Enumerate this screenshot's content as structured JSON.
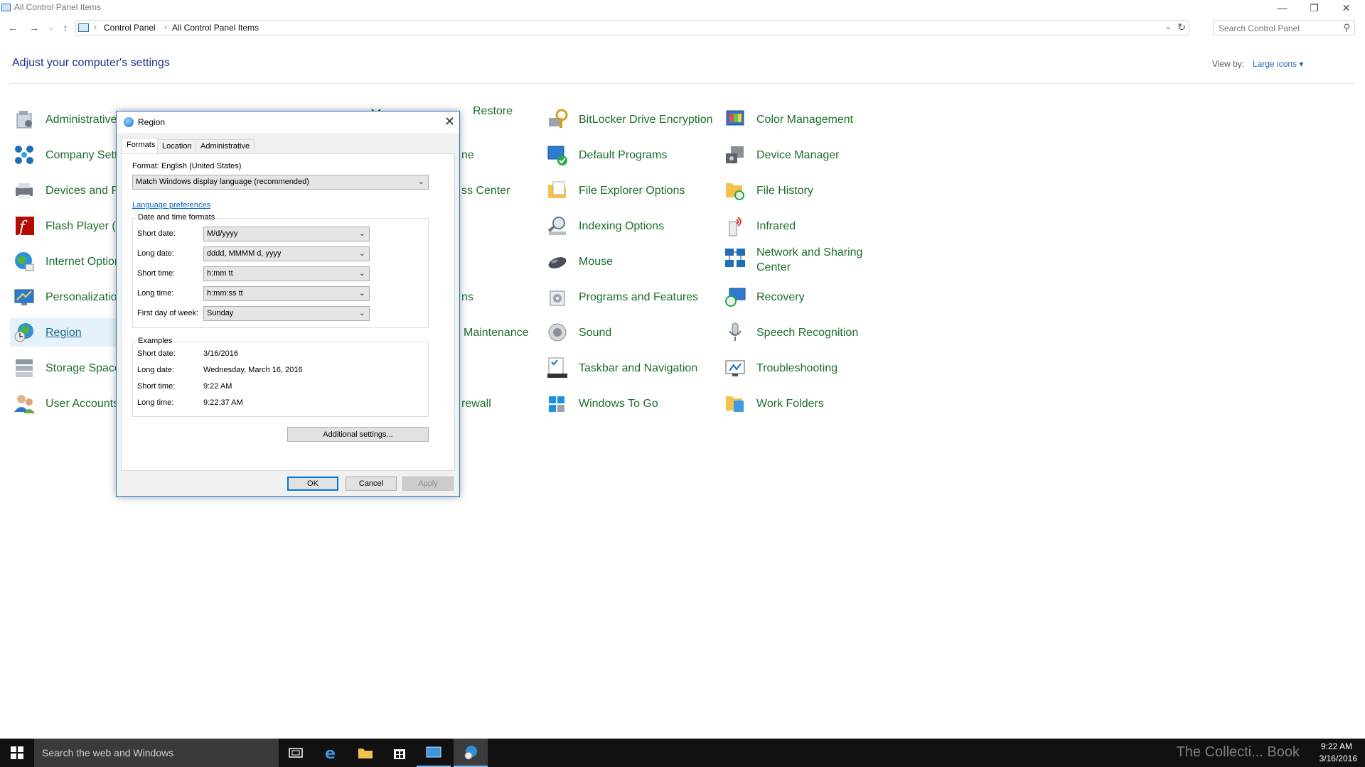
{
  "window": {
    "title": "All Control Panel Items",
    "minimize": "—",
    "restore": "❐",
    "close": "✕"
  },
  "address": {
    "crumbs": [
      "Control Panel",
      "All Control Panel Items"
    ],
    "separator": "›",
    "search_placeholder": "Search Control Panel"
  },
  "header": {
    "title": "Adjust your computer's settings",
    "view_by_label": "View by:",
    "view_by_value": "Large icons ▾"
  },
  "items": {
    "col1": [
      {
        "label": "Administrative",
        "icon": "administrative-tools-icon"
      },
      {
        "label": "Company Setti",
        "icon": "company-settings-icon"
      },
      {
        "label": "Devices and Pr",
        "icon": "devices-printers-icon"
      },
      {
        "label": "Flash Player (3",
        "icon": "flash-player-icon"
      },
      {
        "label": "Internet Option",
        "icon": "internet-options-icon"
      },
      {
        "label": "Personalizatio",
        "icon": "personalization-icon"
      },
      {
        "label": "Region",
        "icon": "region-icon"
      },
      {
        "label": "Storage Spaces",
        "icon": "storage-spaces-icon"
      },
      {
        "label": "User Accounts",
        "icon": "user-accounts-icon"
      }
    ],
    "col2_partial": [
      {
        "label": "Restore"
      },
      {
        "label": "ne"
      },
      {
        "label": "ss Center"
      },
      {
        "label": "ns"
      },
      {
        "label": "Maintenance"
      },
      {
        "label": "rewall"
      }
    ],
    "col3": [
      {
        "label": "BitLocker Drive Encryption",
        "icon": "bitlocker-icon"
      },
      {
        "label": "Default Programs",
        "icon": "default-programs-icon"
      },
      {
        "label": "File Explorer Options",
        "icon": "file-explorer-options-icon"
      },
      {
        "label": "Indexing Options",
        "icon": "indexing-options-icon"
      },
      {
        "label": "Mouse",
        "icon": "mouse-icon"
      },
      {
        "label": "Programs and Features",
        "icon": "programs-features-icon"
      },
      {
        "label": "Sound",
        "icon": "sound-icon"
      },
      {
        "label": "Taskbar and Navigation",
        "icon": "taskbar-navigation-icon"
      },
      {
        "label": "Windows To Go",
        "icon": "windows-to-go-icon"
      }
    ],
    "col4": [
      {
        "label": "Color Management",
        "icon": "color-management-icon"
      },
      {
        "label": "Device Manager",
        "icon": "device-manager-icon"
      },
      {
        "label": "File History",
        "icon": "file-history-icon"
      },
      {
        "label": "Infrared",
        "icon": "infrared-icon"
      },
      {
        "label": "Network and Sharing Center",
        "icon": "network-sharing-icon"
      },
      {
        "label": "Recovery",
        "icon": "recovery-icon"
      },
      {
        "label": "Speech Recognition",
        "icon": "speech-recognition-icon"
      },
      {
        "label": "Troubleshooting",
        "icon": "troubleshooting-icon"
      },
      {
        "label": "Work Folders",
        "icon": "work-folders-icon"
      }
    ]
  },
  "dialog": {
    "title": "Region",
    "close": "✕",
    "tabs": [
      "Formats",
      "Location",
      "Administrative"
    ],
    "active_tab": "Formats",
    "format_label": "Format: English (United States)",
    "format_value": "Match Windows display language (recommended)",
    "language_link": "Language preferences",
    "datetime_group": "Date and time formats",
    "fields": [
      {
        "label": "Short date:",
        "value": "M/d/yyyy"
      },
      {
        "label": "Long date:",
        "value": "dddd, MMMM d, yyyy"
      },
      {
        "label": "Short time:",
        "value": "h:mm tt"
      },
      {
        "label": "Long time:",
        "value": "h:mm:ss tt"
      },
      {
        "label": "First day of week:",
        "value": "Sunday"
      }
    ],
    "examples_group": "Examples",
    "examples": [
      {
        "label": "Short date:",
        "value": "3/16/2016"
      },
      {
        "label": "Long date:",
        "value": "Wednesday, March 16, 2016"
      },
      {
        "label": "Short time:",
        "value": "9:22 AM"
      },
      {
        "label": "Long time:",
        "value": "9:22:37 AM"
      }
    ],
    "additional_settings": "Additional settings...",
    "ok": "OK",
    "cancel": "Cancel",
    "apply": "Apply"
  },
  "taskbar": {
    "search_placeholder": "Search the web and Windows",
    "time": "9:22 AM",
    "date": "3/16/2016",
    "watermark": "The Collecti... Book"
  }
}
